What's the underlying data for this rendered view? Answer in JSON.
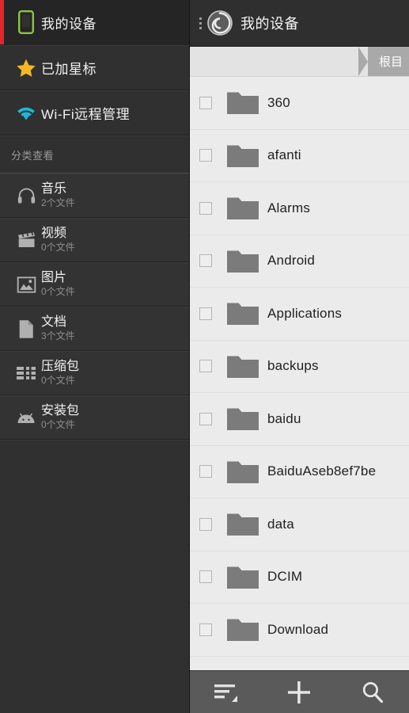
{
  "sidebar": {
    "nav": [
      {
        "label": "我的设备",
        "icon": "phone-icon",
        "active": true,
        "accent": "#e8232a",
        "icon_color": "#8dc63f"
      },
      {
        "label": "已加星标",
        "icon": "star-icon",
        "active": false,
        "icon_color": "#f5b824"
      },
      {
        "label": "Wi-Fi远程管理",
        "icon": "wifi-icon",
        "active": false,
        "icon_color": "#1fb6d6"
      }
    ],
    "section_header": "分类查看",
    "categories": [
      {
        "label": "音乐",
        "count": "2个文件",
        "icon": "headphones-icon"
      },
      {
        "label": "视频",
        "count": "0个文件",
        "icon": "clapperboard-icon"
      },
      {
        "label": "图片",
        "count": "0个文件",
        "icon": "image-icon"
      },
      {
        "label": "文档",
        "count": "3个文件",
        "icon": "document-icon"
      },
      {
        "label": "压缩包",
        "count": "0个文件",
        "icon": "archive-icon"
      },
      {
        "label": "安装包",
        "count": "0个文件",
        "icon": "android-icon"
      }
    ]
  },
  "titlebar": {
    "title": "我的设备",
    "logo_icon": "spiral-logo-icon",
    "menu_icon": "overflow-dots-icon"
  },
  "breadcrumb": {
    "current": "根目"
  },
  "filelist": {
    "items": [
      {
        "name": "360",
        "icon": "folder-icon",
        "checked": false
      },
      {
        "name": "afanti",
        "icon": "folder-icon",
        "checked": false
      },
      {
        "name": "Alarms",
        "icon": "folder-icon",
        "checked": false
      },
      {
        "name": "Android",
        "icon": "folder-icon",
        "checked": false
      },
      {
        "name": "Applications",
        "icon": "folder-icon",
        "checked": false
      },
      {
        "name": "backups",
        "icon": "folder-icon",
        "checked": false
      },
      {
        "name": "baidu",
        "icon": "folder-icon",
        "checked": false
      },
      {
        "name": "BaiduAseb8ef7be",
        "icon": "folder-icon",
        "checked": false
      },
      {
        "name": "data",
        "icon": "folder-icon",
        "checked": false
      },
      {
        "name": "DCIM",
        "icon": "folder-icon",
        "checked": false
      },
      {
        "name": "Download",
        "icon": "folder-icon",
        "checked": false
      }
    ]
  },
  "toolbar": {
    "buttons": [
      {
        "name": "sort-button",
        "icon": "sort-list-icon"
      },
      {
        "name": "add-button",
        "icon": "plus-icon"
      },
      {
        "name": "search-button",
        "icon": "search-icon"
      }
    ]
  },
  "colors": {
    "accent_red": "#e8232a",
    "device_green": "#8dc63f",
    "star_gold": "#f5b824",
    "wifi_blue": "#1fb6d6",
    "sidebar_bg": "#303030",
    "list_bg": "#ebebeb",
    "folder_gray": "#7b7b7b",
    "toolbar_bg": "#5a5a5a"
  }
}
